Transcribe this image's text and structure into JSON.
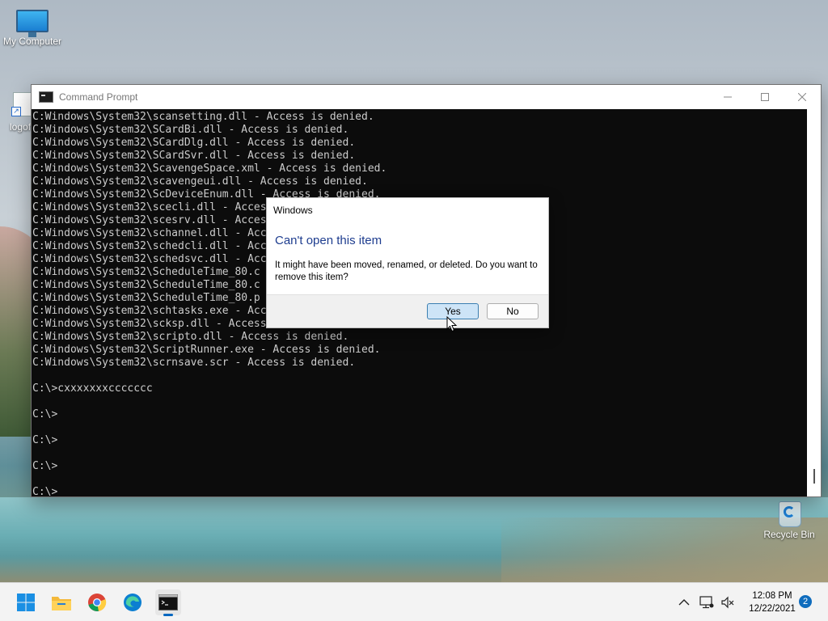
{
  "desktop": {
    "icons": [
      {
        "label": "My Computer"
      },
      {
        "label": "logof"
      },
      {
        "label": "Recycle Bin"
      }
    ]
  },
  "cmd_window": {
    "title": "Command Prompt",
    "output": "C:Windows\\System32\\scansetting.dll - Access is denied.\nC:Windows\\System32\\SCardBi.dll - Access is denied.\nC:Windows\\System32\\SCardDlg.dll - Access is denied.\nC:Windows\\System32\\SCardSvr.dll - Access is denied.\nC:Windows\\System32\\ScavengeSpace.xml - Access is denied.\nC:Windows\\System32\\scavengeui.dll - Access is denied.\nC:Windows\\System32\\ScDeviceEnum.dll - Access is denied.\nC:Windows\\System32\\scecli.dll - Access is denied.\nC:Windows\\System32\\scesrv.dll - Access is denied.\nC:Windows\\System32\\schannel.dll - Access is denied.\nC:Windows\\System32\\schedcli.dll - Access is denied.\nC:Windows\\System32\\schedsvc.dll - Access is denied.\nC:Windows\\System32\\ScheduleTime_80.c\nC:Windows\\System32\\ScheduleTime_80.c\nC:Windows\\System32\\ScheduleTime_80.p\nC:Windows\\System32\\schtasks.exe - Access is denied.\nC:Windows\\System32\\scksp.dll - Access is denied.\nC:Windows\\System32\\scripto.dll - Access is denied.\nC:Windows\\System32\\ScriptRunner.exe - Access is denied.\nC:Windows\\System32\\scrnsave.scr - Access is denied.\n\nC:\\>cxxxxxxxccccccc\n\nC:\\>\n\nC:\\>\n\nC:\\>\n\nC:\\>"
  },
  "dialog": {
    "title": "Windows",
    "heading": "Can't open this item",
    "message": "It might have been moved, renamed, or deleted. Do you want to remove this item?",
    "yes_label": "Yes",
    "no_label": "No"
  },
  "taskbar": {
    "apps": [
      "start",
      "file-explorer",
      "chrome",
      "edge",
      "command-prompt"
    ],
    "active_app": "command-prompt",
    "time": "12:08 PM",
    "date": "12/22/2021",
    "notification_count": "2"
  },
  "colors": {
    "accent": "#0067c0",
    "dialog_heading": "#1e3d8f",
    "console_bg": "#0c0c0c",
    "console_fg": "#cccccc"
  }
}
